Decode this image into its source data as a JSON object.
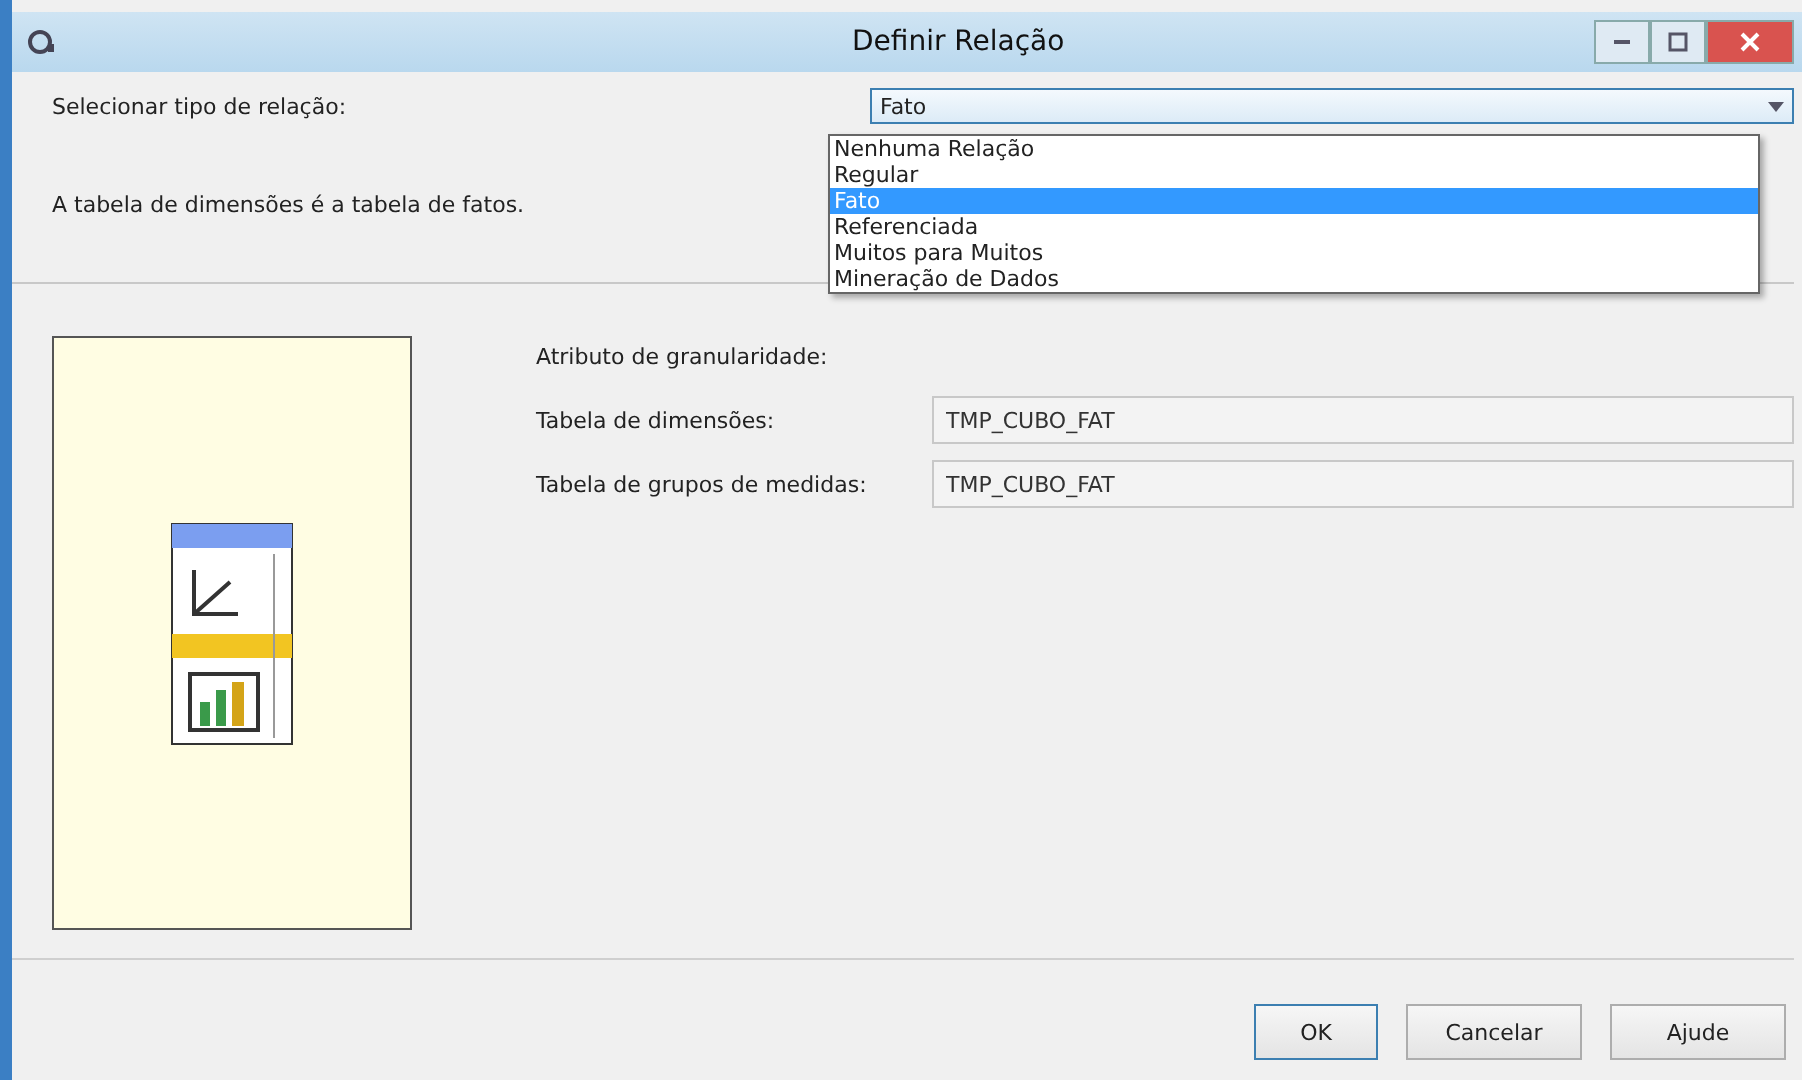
{
  "window": {
    "title": "Definir Relação"
  },
  "relation_type": {
    "label": "Selecionar tipo de relação:",
    "value": "Fato",
    "expanded": true,
    "options": [
      {
        "label": "Nenhuma Relação",
        "selected": false
      },
      {
        "label": "Regular",
        "selected": false
      },
      {
        "label": "Fato",
        "selected": true
      },
      {
        "label": "Referenciada",
        "selected": false
      },
      {
        "label": "Muitos para Muitos",
        "selected": false
      },
      {
        "label": "Mineração de Dados",
        "selected": false
      }
    ]
  },
  "description": "A tabela de dimensões é a tabela de fatos.",
  "fields": [
    {
      "label": "Atributo de granularidade:"
    },
    {
      "label": "Tabela de dimensões:",
      "value": "TMP_CUBO_FAT"
    },
    {
      "label": "Tabela de grupos de medidas:",
      "value": "TMP_CUBO_FAT"
    }
  ],
  "buttons": [
    {
      "label": "OK",
      "default": true
    },
    {
      "label": "Cancelar",
      "default": false
    },
    {
      "label": "Ajude",
      "default": false
    }
  ]
}
